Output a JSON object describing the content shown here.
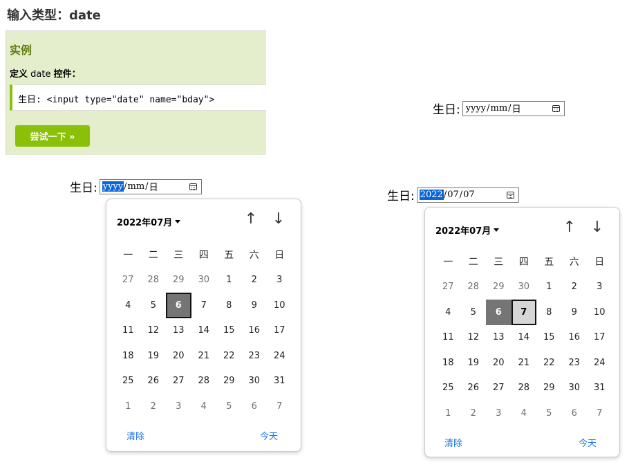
{
  "title": "输入类型：date",
  "example": {
    "heading": "实例",
    "subtitle_prefix": "定义",
    "subtitle_mid": "date",
    "subtitle_suffix": "控件：",
    "code": "生日: <input type=\"date\" name=\"bday\">",
    "try_button": "尝试一下 »"
  },
  "birthday_label": "生日:",
  "input_empty": {
    "year": "yyyy",
    "month": "mm",
    "day": "日"
  },
  "input_filled": {
    "year": "2022",
    "month": "07",
    "day": "07"
  },
  "calendar": {
    "month_label": "2022年07月",
    "up_arrow": "↑",
    "down_arrow": "↓",
    "weekdays": [
      "一",
      "二",
      "三",
      "四",
      "五",
      "六",
      "日"
    ],
    "weeks": [
      [
        "27",
        "28",
        "29",
        "30",
        "1",
        "2",
        "3"
      ],
      [
        "4",
        "5",
        "6",
        "7",
        "8",
        "9",
        "10"
      ],
      [
        "11",
        "12",
        "13",
        "14",
        "15",
        "16",
        "17"
      ],
      [
        "18",
        "19",
        "20",
        "21",
        "22",
        "23",
        "24"
      ],
      [
        "25",
        "26",
        "27",
        "28",
        "29",
        "30",
        "31"
      ],
      [
        "1",
        "2",
        "3",
        "4",
        "5",
        "6",
        "7"
      ]
    ],
    "clear_label": "清除",
    "today_label": "今天"
  },
  "colors": {
    "accent_green": "#8ac007",
    "example_bg": "#e5eecc",
    "heading_green": "#617f10",
    "link_blue": "#1a73e8",
    "selection_blue": "#0a66d8"
  }
}
